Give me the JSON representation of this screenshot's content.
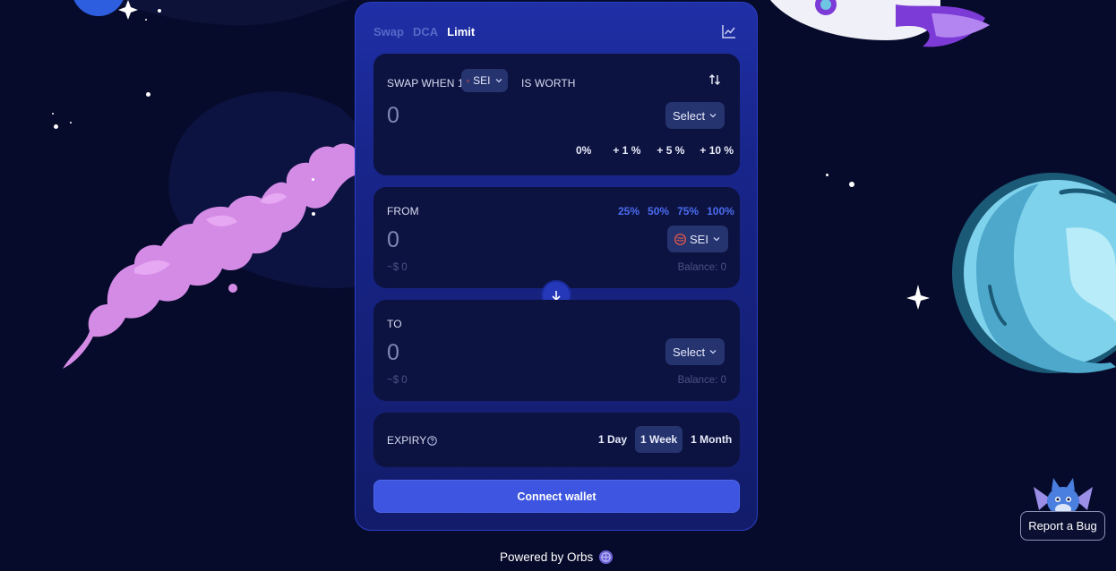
{
  "tabs": [
    {
      "label": "Swap",
      "active": false
    },
    {
      "label": "DCA",
      "active": false
    },
    {
      "label": "Limit",
      "active": true
    }
  ],
  "icons": {
    "chart": "chart-line-icon",
    "flip": "swap-vertical-icon",
    "arrow_down": "arrow-down-icon",
    "chevron": "chevron-down-icon",
    "help": "question-circle-icon",
    "orbs": "orbs-logo-icon",
    "sei": "sei-token-icon"
  },
  "price_panel": {
    "prefix": "SWAP WHEN 1",
    "token": "SEI",
    "suffix": "IS WORTH",
    "value": "0",
    "select_label": "Select",
    "percent_options": [
      "0%",
      "+ 1 %",
      "+ 5 %",
      "+ 10 %"
    ]
  },
  "from_panel": {
    "label": "FROM",
    "percent_options": [
      "25%",
      "50%",
      "75%",
      "100%"
    ],
    "value": "0",
    "token": "SEI",
    "usd_value": "~$ 0",
    "balance": "Balance: 0"
  },
  "to_panel": {
    "label": "TO",
    "value": "0",
    "select_label": "Select",
    "usd_value": "~$ 0",
    "balance": "Balance: 0"
  },
  "expiry": {
    "label": "EXPIRY",
    "options": [
      {
        "label": "1 Day",
        "selected": false
      },
      {
        "label": "1 Week",
        "selected": true
      },
      {
        "label": "1 Month",
        "selected": false
      }
    ]
  },
  "connect_label": "Connect wallet",
  "powered_by": "Powered by Orbs",
  "report_bug": "Report a Bug",
  "colors": {
    "background": "#070b2b",
    "card": "#1a2890",
    "panel": "#0d1340",
    "accent": "#3d55e0",
    "percent_blue": "#4a6cf0"
  }
}
